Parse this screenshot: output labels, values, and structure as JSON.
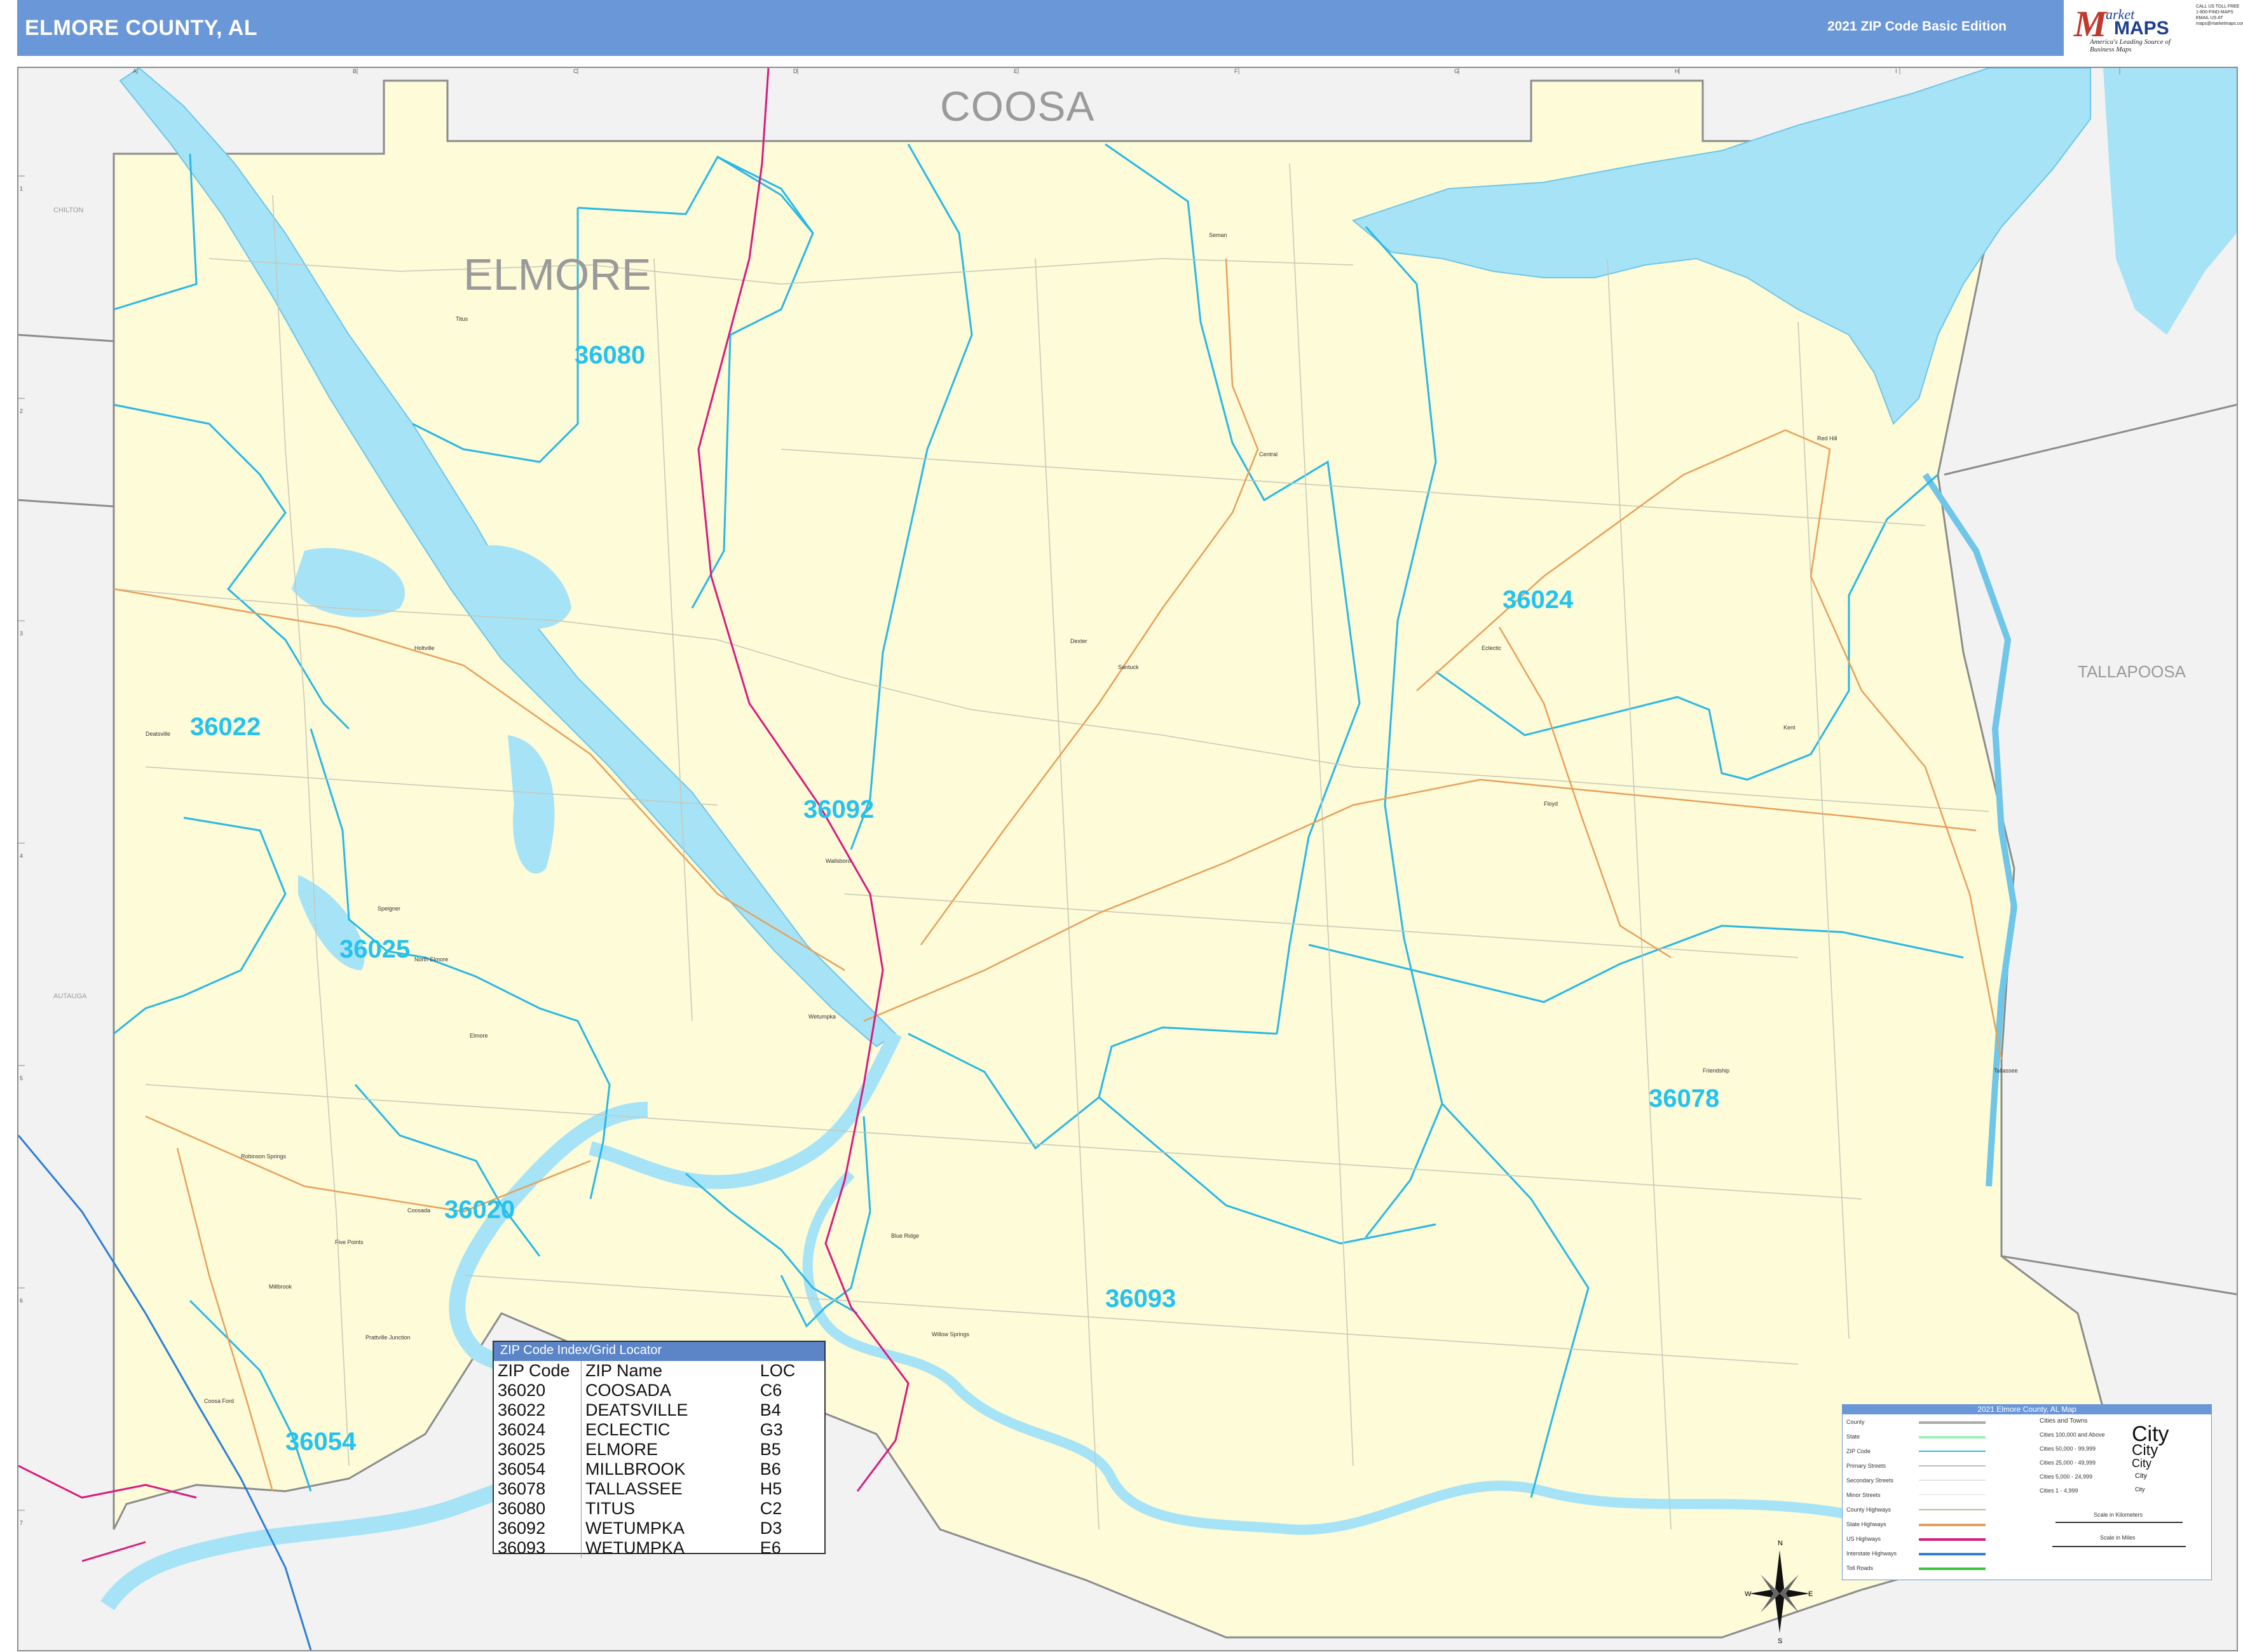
{
  "header": {
    "title": "ELMORE COUNTY, AL",
    "edition": "2021 ZIP Code Basic Edition"
  },
  "logo": {
    "m": "M",
    "arket": "arket",
    "maps": "MAPS",
    "tagline": "America's Leading Source of Business Maps"
  },
  "contact": [
    "CALL US TOLL FREE",
    "1-800-FIND-MAPS",
    "EMAIL US AT",
    "maps@marketmaps.com"
  ],
  "colors": {
    "header": "#6a97d8",
    "county_fill": "#fdfbd8",
    "water": "#a6e3f6",
    "zip_boundary": "#29b8e4",
    "zip_label": "#25c2ee",
    "interstate": "#d81b7e",
    "state_hwy": "#e8a05a"
  },
  "map": {
    "neighbor_counties": {
      "coosa": "COOSA",
      "tallapoosa": "TALLAPOOSA",
      "chilton": "CHILTON",
      "autauga": "AUTAUGA"
    },
    "county_label": "ELMORE",
    "zip_labels": [
      "36080",
      "36024",
      "36022",
      "36092",
      "36025",
      "36078",
      "36020",
      "36093",
      "36054"
    ],
    "towns": [
      "Titus",
      "Seman",
      "Central",
      "Red Hill",
      "Holtville",
      "Dexter",
      "Santuck",
      "Eclectic",
      "Kent",
      "Deatsville",
      "Floyd",
      "Wallsboro",
      "Speigner",
      "North Elmore",
      "Wetumpka",
      "Elmore",
      "Friendship",
      "Tallassee",
      "Robinson Springs",
      "Coosada",
      "Five Points",
      "Millbrook",
      "Blue Ridge",
      "Prattville Junction",
      "Willow Springs",
      "Coosa Ford"
    ],
    "grid_columns": [
      "A",
      "B",
      "C",
      "D",
      "E",
      "F",
      "G",
      "H",
      "I"
    ],
    "grid_rows": [
      "1",
      "2",
      "3",
      "4",
      "5",
      "6",
      "7"
    ]
  },
  "zip_index": {
    "title": "ZIP Code Index/Grid Locator",
    "headers": [
      "ZIP Code",
      "ZIP Name",
      "LOC"
    ],
    "rows": [
      [
        "36020",
        "COOSADA",
        "C6"
      ],
      [
        "36022",
        "DEATSVILLE",
        "B4"
      ],
      [
        "36024",
        "ECLECTIC",
        "G3"
      ],
      [
        "36025",
        "ELMORE",
        "B5"
      ],
      [
        "36054",
        "MILLBROOK",
        "B6"
      ],
      [
        "36078",
        "TALLASSEE",
        "H5"
      ],
      [
        "36080",
        "TITUS",
        "C2"
      ],
      [
        "36092",
        "WETUMPKA",
        "D3"
      ],
      [
        "36093",
        "WETUMPKA",
        "E6"
      ]
    ]
  },
  "legend": {
    "title": "2021 Elmore County, AL Map",
    "items": [
      "County",
      "State",
      "ZIP Code",
      "Primary Streets",
      "Secondary Streets",
      "Minor Streets",
      "County Highways",
      "State Highways",
      "US Highways",
      "Interstate Highways",
      "Toll Roads"
    ],
    "cities_header": "Cities and Towns",
    "city_classes": [
      "Cities 100,000 and Above",
      "Cities 50,000 - 99,999",
      "Cities 25,000 - 49,999",
      "Cities 5,000 - 24,999",
      "Cities 1 - 4,999"
    ],
    "city_word": "City",
    "scale_km": "Scale in Kilometers",
    "scale_mi": "Scale in Miles"
  },
  "compass": {
    "n": "N",
    "s": "S",
    "e": "E",
    "w": "W"
  }
}
